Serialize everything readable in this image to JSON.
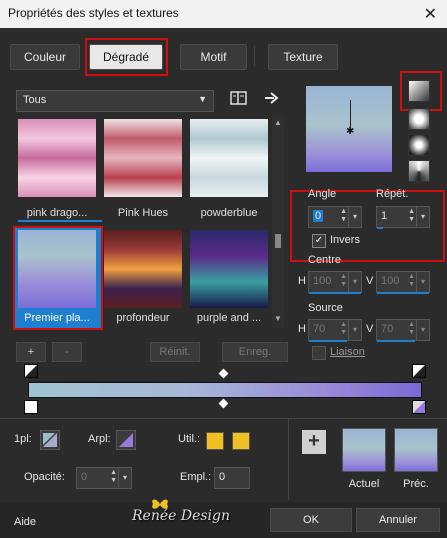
{
  "window": {
    "title": "Propriétés des styles et textures",
    "close": "✕"
  },
  "tabs": [
    {
      "label": "Couleur"
    },
    {
      "label": "Dégradé"
    },
    {
      "label": "Motif"
    },
    {
      "label": "Texture"
    }
  ],
  "filter": {
    "value": "Tous"
  },
  "gradients": [
    {
      "label": "pink drago...",
      "colors": [
        "#d98fb8",
        "#f2c7dc",
        "#c66b9c",
        "#f7d4e5",
        "#d98fb8"
      ]
    },
    {
      "label": "Pink Hues",
      "colors": [
        "#f0e2e6",
        "#c05a6a",
        "#e7b6c0",
        "#b8404e",
        "#f3e6ea"
      ]
    },
    {
      "label": "powderblue",
      "colors": [
        "#e6eef0",
        "#b0c8cf",
        "#f0f4f5",
        "#c8d8dc",
        "#e6eef0"
      ]
    },
    {
      "label": "Premier pla...",
      "colors": [
        "#9ab4d6",
        "#a9c3cc",
        "#9c8fd8",
        "#7a6ed8"
      ]
    },
    {
      "label": "profondeur",
      "colors": [
        "#5a1e1e",
        "#9b3a3a",
        "#f0a040",
        "#3c2050",
        "#5a1e1e"
      ]
    },
    {
      "label": "purple and ...",
      "colors": [
        "#2a2a6a",
        "#5a2a8a",
        "#3aa0a0",
        "#1a1a4a"
      ]
    }
  ],
  "buttons": {
    "add": "+",
    "remove": "-",
    "reset": "Réinit.",
    "save": "Enreg."
  },
  "angle": {
    "label": "Angle",
    "value": "0"
  },
  "repeat": {
    "label": "Répét.",
    "value": "1"
  },
  "invert": {
    "label": "Invers",
    "checked": true
  },
  "center": {
    "label": "Centre",
    "h_label": "H",
    "h_value": "100",
    "v_label": "V",
    "v_value": "100"
  },
  "source": {
    "label": "Source",
    "h_label": "H",
    "h_value": "70",
    "v_label": "V",
    "v_value": "70"
  },
  "link": {
    "label": "Liaison"
  },
  "bottom": {
    "fg_label": "1pl:",
    "bg_label": "Arpl:",
    "util_label": "Util.:",
    "opacity_label": "Opacité:",
    "opacity_value": "0",
    "empl_label": "Empl.:",
    "empl_value": "0",
    "current_label": "Actuel",
    "previous_label": "Préc."
  },
  "footer": {
    "help": "Aide",
    "watermark": "Renée Design",
    "ok": "OK",
    "cancel": "Annuler"
  },
  "colors": {
    "accent": "#1e7fd0",
    "highlight": "#d01010",
    "gold": "#f0c020",
    "purple": "#9a7ad8"
  }
}
